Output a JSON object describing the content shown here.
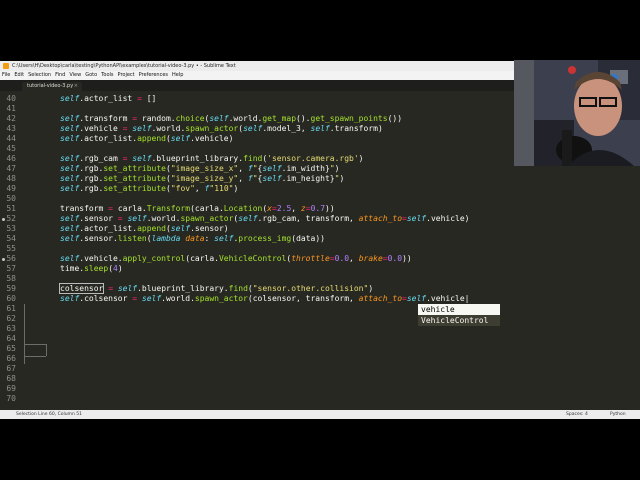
{
  "window": {
    "title": "C:\\Users\\H\\Desktop\\carla\\testing\\PythonAPI\\examples\\tutorial-video-3.py • - Sublime Text",
    "controls": [
      "–",
      "□",
      "✕"
    ]
  },
  "menu": [
    "File",
    "Edit",
    "Selection",
    "Find",
    "View",
    "Goto",
    "Tools",
    "Project",
    "Preferences",
    "Help"
  ],
  "tab": {
    "label": "tutorial-video-3.py",
    "close": "×"
  },
  "line_numbers": [
    "40",
    "41",
    "42",
    "43",
    "44",
    "45",
    "46",
    "47",
    "48",
    "49",
    "50",
    "51",
    "52",
    "53",
    "54",
    "55",
    "56",
    "57",
    "58",
    "59",
    "60",
    "61",
    "62",
    "63",
    "64",
    "65",
    "66",
    "67",
    "68",
    "69",
    "70",
    "71"
  ],
  "autocomplete": [
    "vehicle",
    "VehicleControl"
  ],
  "status": {
    "left": "Selection Line 60, Column 51",
    "spaces": "Spaces: 4",
    "language": "Python"
  },
  "colors": {
    "background": "#272822",
    "foreground": "#f8f8f2",
    "keyword": "#66d9ef",
    "string": "#e6db74",
    "number": "#ae81ff",
    "operator": "#f92672",
    "function": "#a6e22e",
    "param": "#fd971f"
  },
  "icons": {
    "app": "sublime-text-icon"
  }
}
